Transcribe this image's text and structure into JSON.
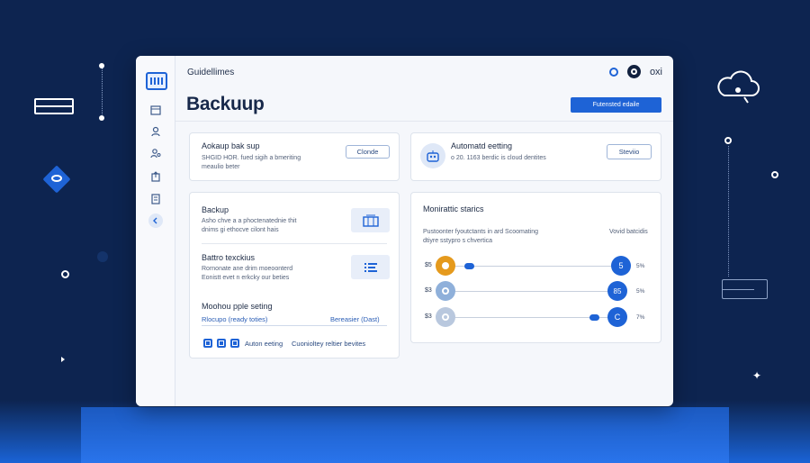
{
  "app": {
    "brand": "Guidellimes",
    "title": "Backuup",
    "header_button": "Futensted edaile",
    "header_text": "oxi"
  },
  "sidebar": {
    "icons": [
      "calendar-icon",
      "user-icon",
      "person-gear-icon",
      "share-icon",
      "document-icon",
      "chevron-left-icon"
    ]
  },
  "card_backup_top": {
    "title": "Aokaup bak sup",
    "desc_line1": "SHGID HOR. fued sigih a bmeriting",
    "desc_line2": "meaulio beter",
    "button": "Clonde"
  },
  "card_auto": {
    "title": "Automatd eetting",
    "desc": "o 20. 1163 berdic is cloud dentites",
    "button": "Steviio"
  },
  "card_list": {
    "item1": {
      "title": "Backup",
      "line1": "Asho chve a a phoctenatednie thit",
      "line2": "dnims gi ethocve cilont hais"
    },
    "item2": {
      "title": "Battro texckius",
      "line1": "Rornonate ane drim moeoonterd",
      "line2": "Eonistt evet n erkcky our beties"
    },
    "item3": {
      "title": "Moohou pple seting",
      "link_left": "Rlocupo (ready toties)",
      "link_right": "Bereasier (Dast)",
      "check_label1": "Auton eeting",
      "check_label2": "Cuonioltey reltier bevites"
    }
  },
  "card_stats": {
    "title": "Monirattic starics",
    "desc_line1": "Pustoonter fyoutctants in ard Scoomating",
    "desc_line2": "dtiyre sstypro s chvertica",
    "side_label": "Vovid batcidis",
    "rows": [
      {
        "currency": "$5",
        "knob_label": "5",
        "pct": "5%",
        "left_color": "#e59a1d",
        "right_color": "#1e63d6",
        "level": 1.0
      },
      {
        "currency": "$3",
        "knob_label": "85",
        "pct": "5%",
        "left_color": "#8fb0da",
        "right_color": "#1e63d6",
        "level": 1.0
      },
      {
        "currency": "$3",
        "knob_label": "C",
        "pct": "7%",
        "left_color": "#b9c8de",
        "right_color": "#1e63d6",
        "level": 0.95
      }
    ]
  },
  "colors": {
    "accent": "#1e63d6",
    "background": "#0d2450",
    "window": "#f5f7fb"
  }
}
